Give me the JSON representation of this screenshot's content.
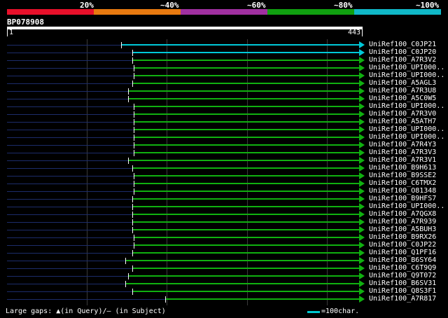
{
  "colors": {
    "scale": [
      "#e8102a",
      "#e87a10",
      "#a030a0",
      "#10a010",
      "#10b8c8"
    ],
    "hit_cyan": "#00c8d8",
    "hit_green": "#10b010",
    "hit_ticks": "#ffffff",
    "dim_line": "#1c2c6a",
    "grid": "#3a3a3a"
  },
  "scale_labels": [
    "20%",
    "~40%",
    "~60%",
    "~80%",
    "~100%"
  ],
  "query": {
    "name": "BP078908",
    "start": "1",
    "end": "443",
    "length": 443
  },
  "hits": [
    {
      "name": "UniRef100_C0JP21",
      "start": 143,
      "color": "cyan"
    },
    {
      "name": "UniRef100_C0JP20",
      "start": 157,
      "color": "cyan"
    },
    {
      "name": "UniRef100_A7R3V2",
      "start": 157,
      "color": "green"
    },
    {
      "name": "UniRef100_UPI000..",
      "start": 159,
      "color": "green"
    },
    {
      "name": "UniRef100_UPI000..",
      "start": 159,
      "color": "green"
    },
    {
      "name": "UniRef100_A5AGL3",
      "start": 157,
      "color": "green"
    },
    {
      "name": "UniRef100_A7R3U8",
      "start": 152,
      "color": "green"
    },
    {
      "name": "UniRef100_A5C0W5",
      "start": 152,
      "color": "green"
    },
    {
      "name": "UniRef100_UPI000..",
      "start": 159,
      "color": "green"
    },
    {
      "name": "UniRef100_A7R3V0",
      "start": 159,
      "color": "green"
    },
    {
      "name": "UniRef100_A5ATH7",
      "start": 159,
      "color": "green"
    },
    {
      "name": "UniRef100_UPI000..",
      "start": 159,
      "color": "green"
    },
    {
      "name": "UniRef100_UPI000..",
      "start": 159,
      "color": "green"
    },
    {
      "name": "UniRef100_A7R4Y3",
      "start": 159,
      "color": "green"
    },
    {
      "name": "UniRef100_A7R3V3",
      "start": 159,
      "color": "green"
    },
    {
      "name": "UniRef100_A7R3V1",
      "start": 152,
      "color": "green"
    },
    {
      "name": "UniRef100_B9H613",
      "start": 157,
      "color": "green"
    },
    {
      "name": "UniRef100_B9SSE2",
      "start": 159,
      "color": "green"
    },
    {
      "name": "UniRef100_C6TMX2",
      "start": 159,
      "color": "green"
    },
    {
      "name": "UniRef100_O81348",
      "start": 159,
      "color": "green"
    },
    {
      "name": "UniRef100_B9HFS7",
      "start": 157,
      "color": "green"
    },
    {
      "name": "UniRef100_UPI000..",
      "start": 157,
      "color": "green"
    },
    {
      "name": "UniRef100_A7QGX8",
      "start": 157,
      "color": "green"
    },
    {
      "name": "UniRef100_A7R939",
      "start": 157,
      "color": "green"
    },
    {
      "name": "UniRef100_A5BUH3",
      "start": 157,
      "color": "green"
    },
    {
      "name": "UniRef100_B9RX26",
      "start": 159,
      "color": "green"
    },
    {
      "name": "UniRef100_C0JP22",
      "start": 159,
      "color": "green"
    },
    {
      "name": "UniRef100_Q1PF16",
      "start": 157,
      "color": "green"
    },
    {
      "name": "UniRef100_B6SY64",
      "start": 148,
      "color": "green"
    },
    {
      "name": "UniRef100_C6T9Q9",
      "start": 157,
      "color": "green"
    },
    {
      "name": "UniRef100_Q9T072",
      "start": 152,
      "color": "green"
    },
    {
      "name": "UniRef100_B6SV31",
      "start": 148,
      "color": "green"
    },
    {
      "name": "UniRef100_Q8S3F1",
      "start": 157,
      "color": "green"
    },
    {
      "name": "UniRef100_A7R817",
      "start": 198,
      "color": "green"
    }
  ],
  "footer": {
    "gaps_text": "Large gaps: ▲(in Query)/– (in Subject)",
    "legend_text": "=100char."
  }
}
